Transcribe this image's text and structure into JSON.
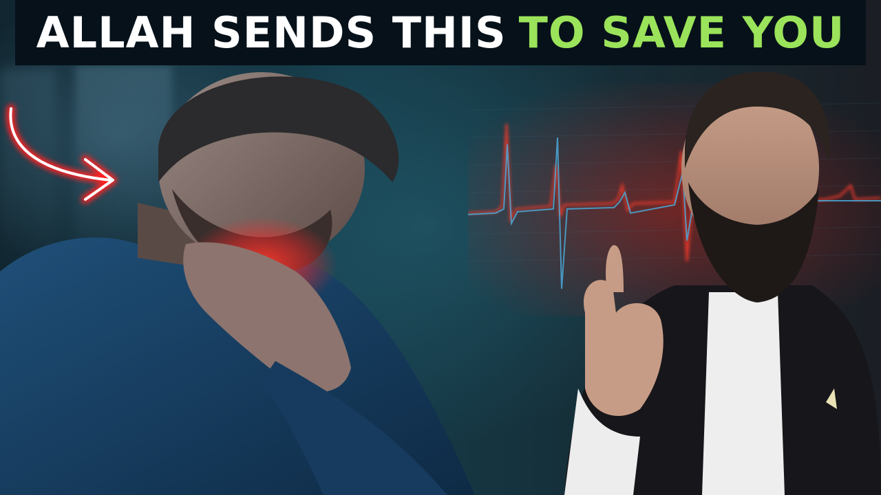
{
  "title": {
    "part1": "ALLAH SENDS THIS",
    "part2": "TO SAVE YOU"
  },
  "colors": {
    "title_bg": "#06111a",
    "title_white": "#ffffff",
    "title_green": "#9be35a",
    "glow_red": "#ff2a2a",
    "ecg_red": "#e2372a",
    "ecg_blue": "#4aa8d8"
  },
  "icons": {
    "arrow": "curved-arrow-icon",
    "pain_glow": "pain-glow-icon",
    "heartbeat": "heartbeat-line-icon"
  }
}
